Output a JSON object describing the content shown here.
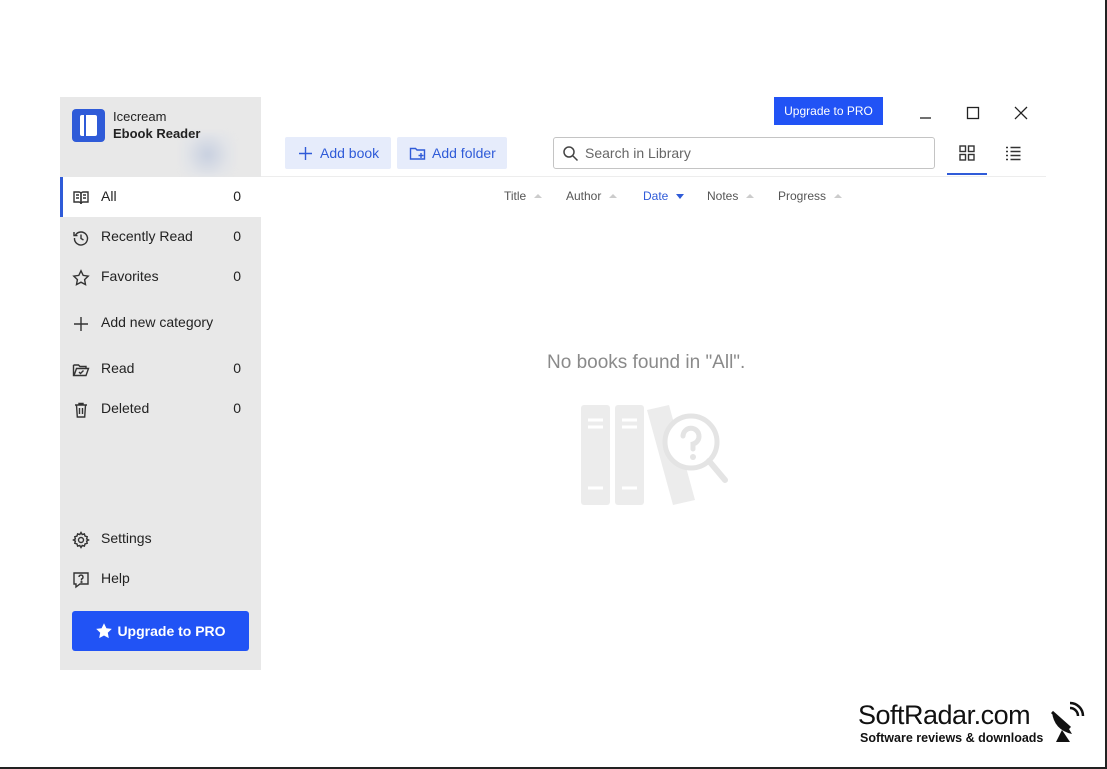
{
  "brand": {
    "line1": "Icecream",
    "line2": "Ebook Reader"
  },
  "sidebar": {
    "items": [
      {
        "label": "All",
        "count": "0"
      },
      {
        "label": "Recently Read",
        "count": "0"
      },
      {
        "label": "Favorites",
        "count": "0"
      },
      {
        "label": "Add new category"
      },
      {
        "label": "Read",
        "count": "0"
      },
      {
        "label": "Deleted",
        "count": "0"
      },
      {
        "label": "Settings"
      },
      {
        "label": "Help"
      }
    ],
    "upgrade_label": "Upgrade to PRO"
  },
  "header": {
    "upgrade_label": "Upgrade to PRO",
    "add_book_label": "Add book",
    "add_folder_label": "Add folder",
    "search_placeholder": "Search in Library"
  },
  "columns": [
    "Title",
    "Author",
    "Date",
    "Notes",
    "Progress"
  ],
  "active_sort": "Date",
  "empty_message": "No books found in \"All\".",
  "watermark": {
    "title": "SoftRadar.com",
    "subtitle": "Software reviews & downloads"
  },
  "colors": {
    "accent": "#2f5bd8",
    "button": "#2153f5",
    "sidebar_bg": "#e8e8e8"
  }
}
